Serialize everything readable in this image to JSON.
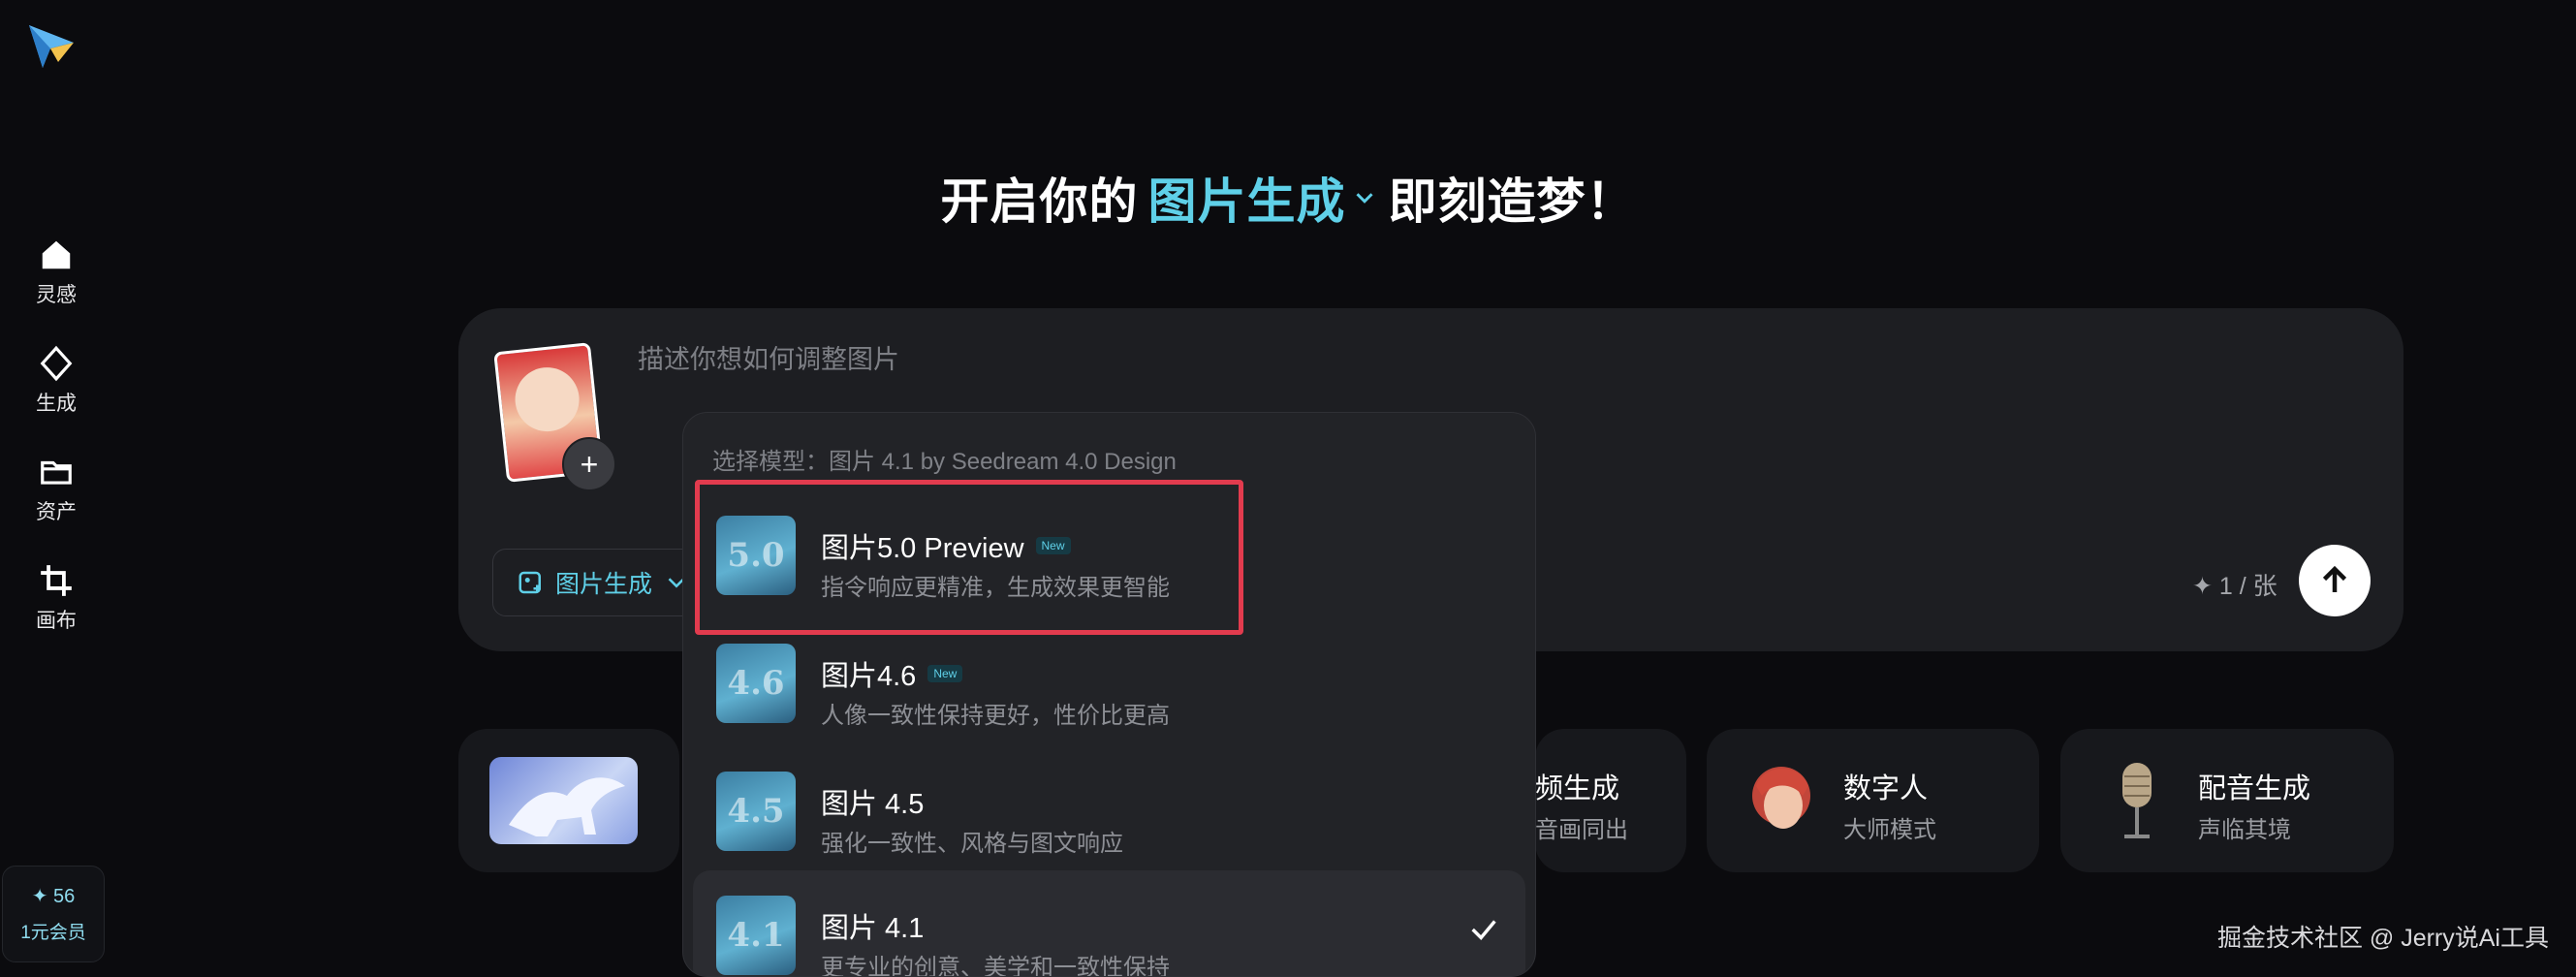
{
  "sidebar": {
    "logo_icon": "paper-plane-logo-icon",
    "items": [
      {
        "icon": "home-icon",
        "label": "灵感"
      },
      {
        "icon": "diamond-icon",
        "label": "生成"
      },
      {
        "icon": "folder-icon",
        "label": "资产"
      },
      {
        "icon": "crop-icon",
        "label": "画布"
      }
    ],
    "credits": {
      "count": "✦ 56",
      "membership": "1元会员"
    }
  },
  "hero": {
    "prefix": "开启你的",
    "mode": "图片生成",
    "suffix": "即刻造梦！"
  },
  "composer": {
    "placeholder": "描述你想如何调整图片",
    "mode_label": "图片生成",
    "cost": "✦ 1 / 张"
  },
  "cards": [
    {
      "title": "数字人",
      "subtitle": "大师模式"
    },
    {
      "title": "配音生成",
      "subtitle": "声临其境"
    }
  ],
  "partial_card": {
    "title_fragment": "频生成",
    "subtitle_fragment": "音画同出"
  },
  "dropdown": {
    "header": "选择模型：图片 4.1 by Seedream 4.0 Design",
    "models": [
      {
        "name": "图片5.0 Preview",
        "badge": "New",
        "desc": "指令响应更精准，生成效果更智能",
        "icon_text": "5.0"
      },
      {
        "name": "图片4.6",
        "badge": "New",
        "desc": "人像一致性保持更好，性价比更高",
        "icon_text": "4.6"
      },
      {
        "name": "图片 4.5",
        "badge": "",
        "desc": "强化一致性、风格与图文响应",
        "icon_text": "4.5"
      },
      {
        "name": "图片 4.1",
        "badge": "",
        "desc": "更专业的创意、美学和一致性保持",
        "icon_text": "4.1",
        "selected": true
      }
    ]
  },
  "colors": {
    "accent": "#5fd0e8",
    "highlight": "#e23b4e",
    "background": "#0b0b0e"
  },
  "watermark": "掘金技术社区 @ Jerry说Ai工具"
}
